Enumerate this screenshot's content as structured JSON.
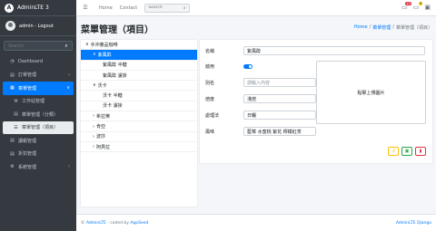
{
  "brand": {
    "logo": "A",
    "name": "AdminLTE 3"
  },
  "user": {
    "label": "admin - Logout"
  },
  "sidebar": {
    "search_placeholder": "Search",
    "items": [
      {
        "icon": "◔",
        "label": "Dashboard"
      },
      {
        "icon": "▤",
        "label": "訂單管理"
      },
      {
        "icon": "▦",
        "label": "菜單管理"
      },
      {
        "icon": "⚒",
        "label": "工作站管理"
      },
      {
        "icon": "▤",
        "label": "菜單管理（分類）"
      },
      {
        "icon": "☰",
        "label": "菜單管理（項目）"
      },
      {
        "icon": "▤",
        "label": "讀報管理"
      },
      {
        "icon": "▤",
        "label": "折扣管理"
      },
      {
        "icon": "⚙",
        "label": "系統管理"
      }
    ]
  },
  "topbar": {
    "home": "Home",
    "contact": "Contact",
    "search_placeholder": "Search",
    "badge1": "15",
    "badge2": "3"
  },
  "page": {
    "title": "菜單管理（項目）"
  },
  "breadcrumb": [
    "Home",
    "菜單管理",
    "菜單管理（項目）"
  ],
  "tree": [
    {
      "arrow": "∨",
      "label": "手沖蕎品咖啡"
    },
    {
      "arrow": "∨",
      "label": "紫風酔"
    },
    {
      "arrow": "",
      "label": "紫風酔 半糖"
    },
    {
      "arrow": "",
      "label": "紫風酔 濾掛"
    },
    {
      "arrow": "∨",
      "label": "沃卡"
    },
    {
      "arrow": "",
      "label": "沃卡 半糖"
    },
    {
      "arrow": "",
      "label": "沃卡 濾掛"
    },
    {
      "arrow": "›",
      "label": "希拉樂"
    },
    {
      "arrow": "›",
      "label": "肯亞"
    },
    {
      "arrow": "›",
      "label": "波莎"
    },
    {
      "arrow": "›",
      "label": "阿貝拉"
    }
  ],
  "form": {
    "name_label": "名稱",
    "name_value": "紫風酔",
    "enabled_label": "啟用",
    "alias_label": "別名",
    "alias_placeholder": "請輸入內容",
    "roast_label": "焙度",
    "roast_value": "淺焙",
    "process_label": "處理法",
    "process_value": "日曬",
    "flavor_label": "風味",
    "flavor_value": "藍莓 水蜜桃 紫花 檸檬紅茶",
    "upload_label": "點擊上傳圖片"
  },
  "footer": {
    "left_prefix": "©",
    "left_link": "AdminLTE",
    "left_mid": "- coded by",
    "left_author": "AppSeed",
    "right": "AdminLTE Django"
  }
}
